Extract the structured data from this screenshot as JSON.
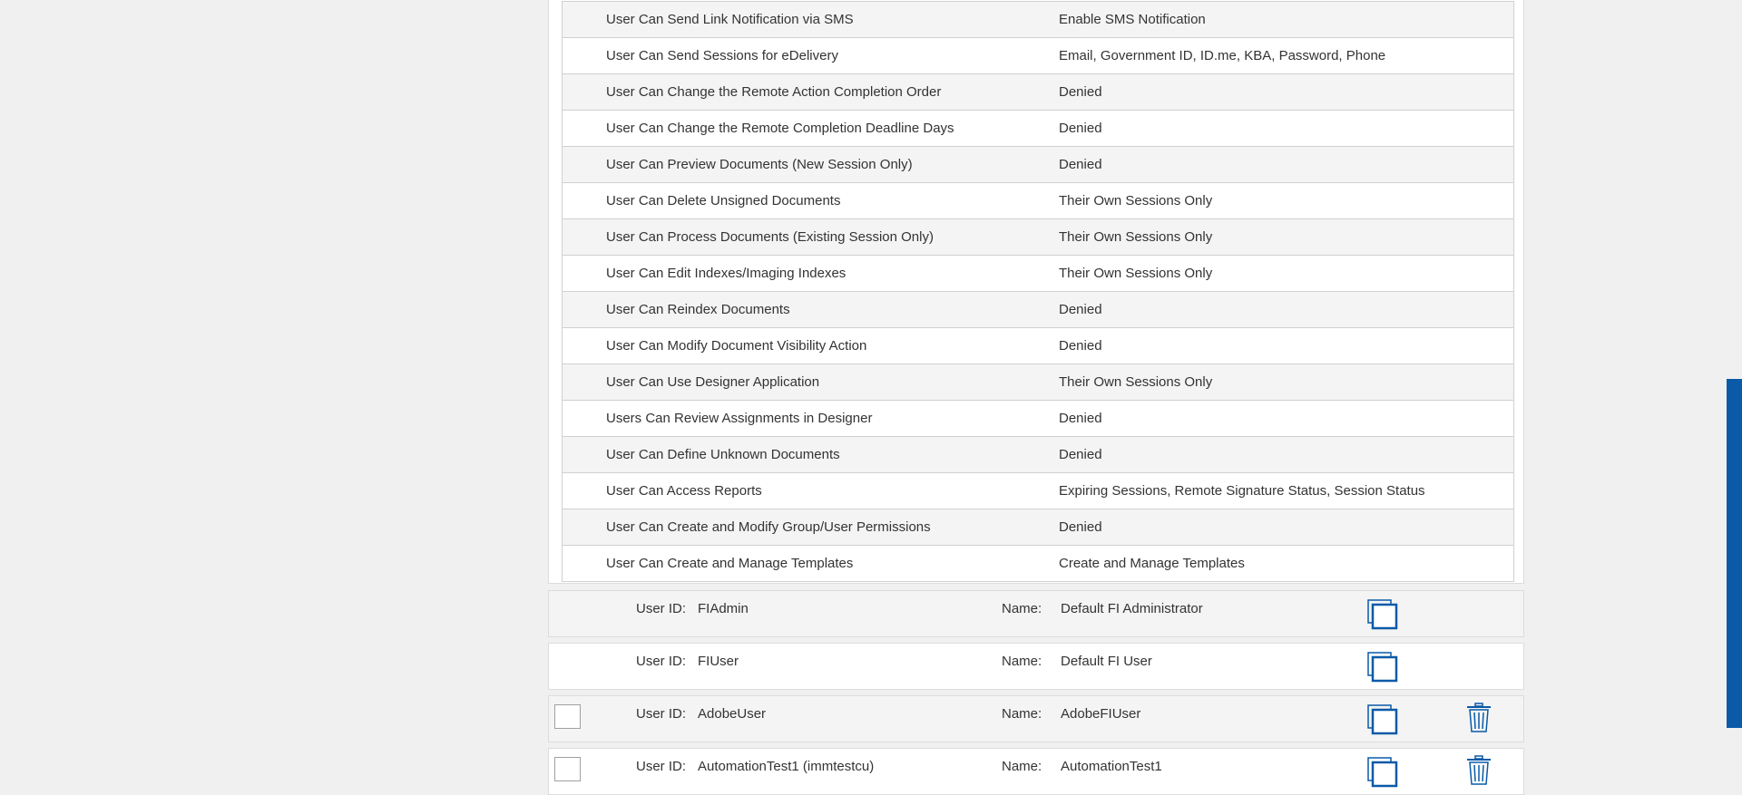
{
  "permissions": [
    {
      "label": "User Can Send Link Notification via SMS",
      "value": "Enable SMS Notification"
    },
    {
      "label": "User Can Send Sessions for eDelivery",
      "value": "Email, Government ID, ID.me, KBA, Password, Phone"
    },
    {
      "label": "User Can Change the Remote Action Completion Order",
      "value": "Denied"
    },
    {
      "label": "User Can Change the Remote Completion Deadline Days",
      "value": "Denied"
    },
    {
      "label": "User Can Preview Documents (New Session Only)",
      "value": "Denied"
    },
    {
      "label": "User Can Delete Unsigned Documents",
      "value": "Their Own Sessions Only"
    },
    {
      "label": "User Can Process Documents (Existing Session Only)",
      "value": "Their Own Sessions Only"
    },
    {
      "label": "User Can Edit Indexes/Imaging Indexes",
      "value": "Their Own Sessions Only"
    },
    {
      "label": "User Can Reindex Documents",
      "value": "Denied"
    },
    {
      "label": "User Can Modify Document Visibility Action",
      "value": "Denied"
    },
    {
      "label": "User Can Use Designer Application",
      "value": "Their Own Sessions Only"
    },
    {
      "label": "Users Can Review Assignments in Designer",
      "value": "Denied"
    },
    {
      "label": "User Can Define Unknown Documents",
      "value": "Denied"
    },
    {
      "label": "User Can Access Reports",
      "value": "Expiring Sessions, Remote Signature Status, Session Status"
    },
    {
      "label": "User Can Create and Modify Group/User Permissions",
      "value": "Denied"
    },
    {
      "label": "User Can Create and Manage Templates",
      "value": "Create and Manage Templates"
    }
  ],
  "user_labels": {
    "user_id": "User ID:",
    "name": "Name:"
  },
  "users": [
    {
      "user_id": "FIAdmin",
      "name": "Default FI Administrator",
      "has_checkbox": false,
      "has_delete": false
    },
    {
      "user_id": "FIUser",
      "name": "Default FI User",
      "has_checkbox": false,
      "has_delete": false
    },
    {
      "user_id": "AdobeUser",
      "name": "AdobeFIUser",
      "has_checkbox": true,
      "has_delete": true
    },
    {
      "user_id": "AutomationTest1 (immtestcu)",
      "name": "AutomationTest1",
      "has_checkbox": true,
      "has_delete": true
    }
  ],
  "icons": {
    "copy": "copy-icon",
    "delete": "trash-icon"
  },
  "colors": {
    "accent": "#0a5aa8",
    "row_alt": "#f4f4f4",
    "background": "#f0f0f0"
  }
}
